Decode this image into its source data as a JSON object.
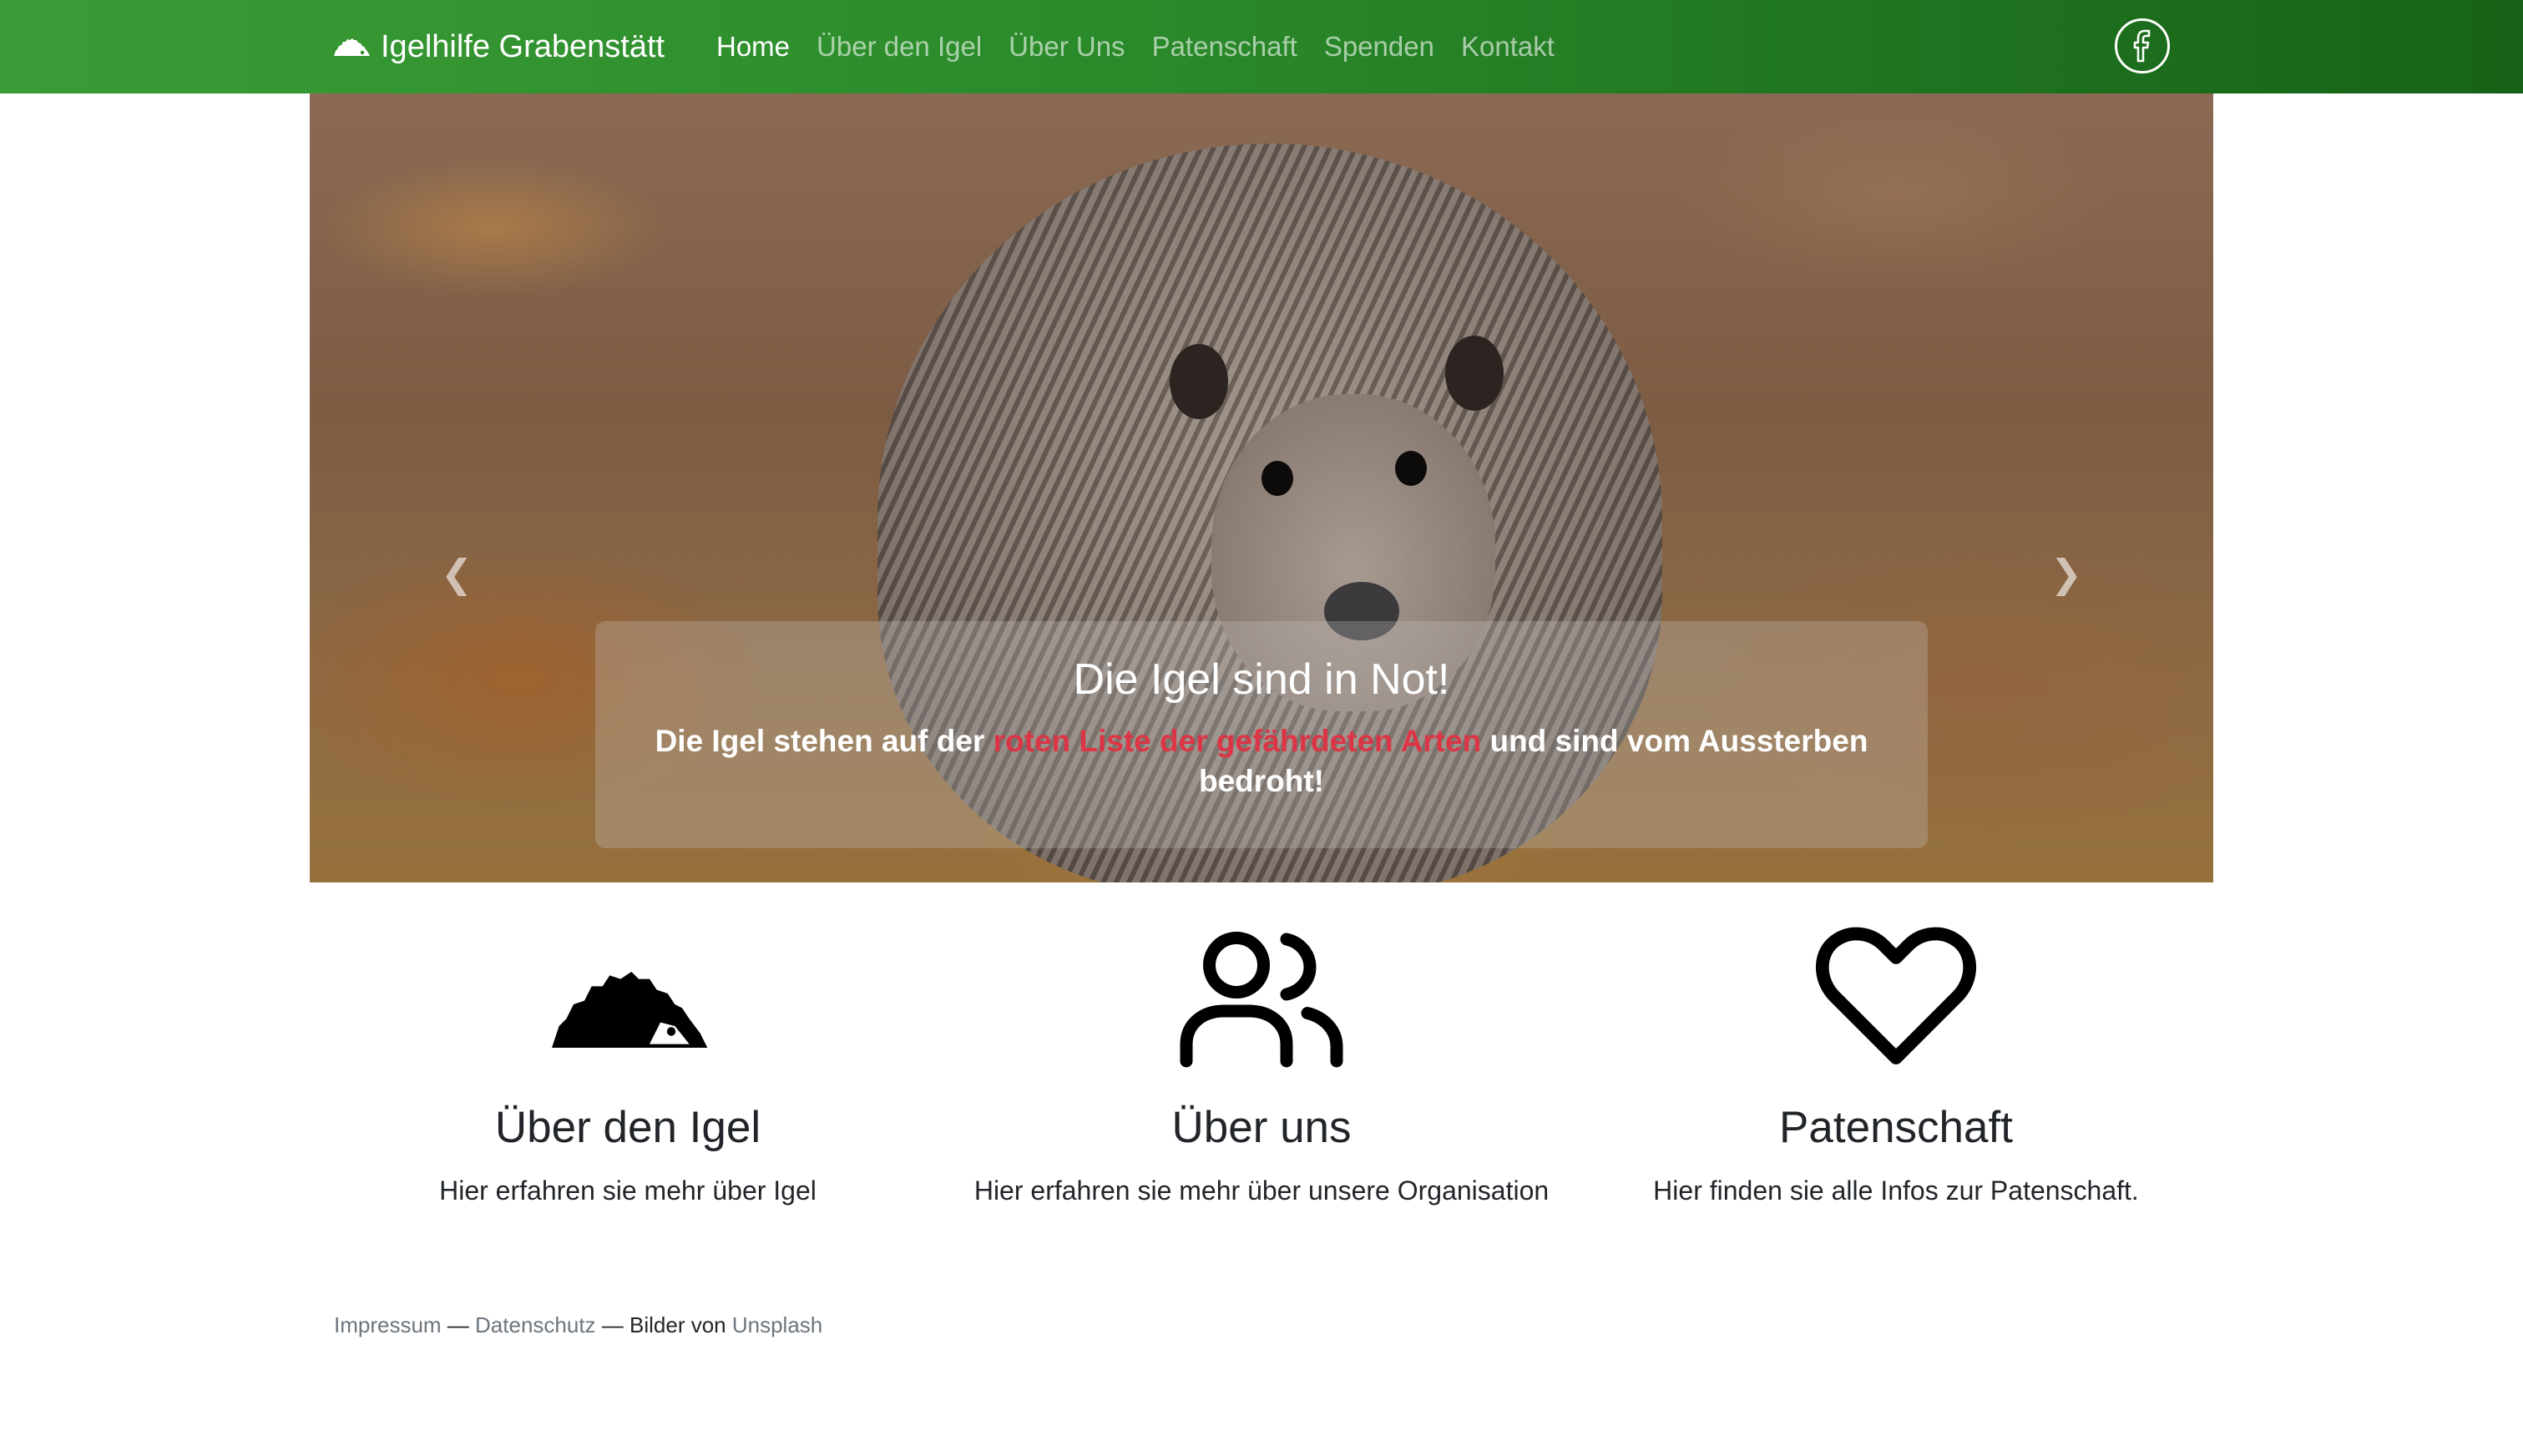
{
  "navbar": {
    "brand": "Igelhilfe Grabenstätt",
    "brand_icon": "hedgehog-icon",
    "links": [
      {
        "label": "Home",
        "active": true
      },
      {
        "label": "Über den Igel",
        "active": false
      },
      {
        "label": "Über Uns",
        "active": false
      },
      {
        "label": "Patenschaft",
        "active": false
      },
      {
        "label": "Spenden",
        "active": false
      },
      {
        "label": "Kontakt",
        "active": false
      }
    ],
    "social_icon": "facebook-icon"
  },
  "carousel": {
    "caption_title": "Die Igel sind in Not!",
    "caption_text_before": "Die Igel stehen auf der ",
    "caption_text_highlight": "roten Liste der gefährdeten Arten",
    "caption_text_after": " und sind vom Aussterben bedroht!",
    "highlight_color": "#dc3545",
    "prev_icon": "chevron-left-icon",
    "next_icon": "chevron-right-icon",
    "slide_count": 4,
    "active_slide": 2
  },
  "features": [
    {
      "icon": "hedgehog-icon",
      "title": "Über den Igel",
      "text": "Hier erfahren sie mehr über Igel"
    },
    {
      "icon": "users-icon",
      "title": "Über uns",
      "text": "Hier erfahren sie mehr über unsere Organisation"
    },
    {
      "icon": "heart-icon",
      "title": "Patenschaft",
      "text": "Hier finden sie alle Infos zur Patenschaft."
    }
  ],
  "footer": {
    "impressum": "Impressum",
    "sep1": " — ",
    "datenschutz": "Datenschutz",
    "sep2": " — Bilder von ",
    "unsplash": "Unsplash"
  },
  "colors": {
    "navbar_start": "#3a9c36",
    "navbar_end": "#176218"
  }
}
